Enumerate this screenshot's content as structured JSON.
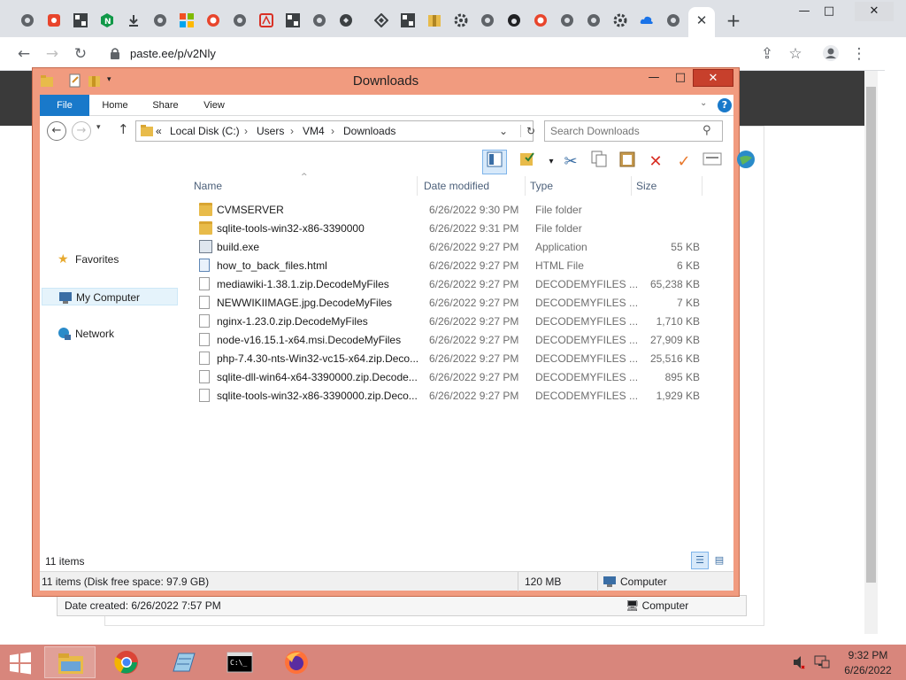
{
  "browser": {
    "url": "paste.ee/p/v2Nly",
    "tab_icons": [
      "chrome-icon",
      "pdf-icon",
      "qr-icon",
      "nginx-icon",
      "download-icon",
      "chrome-icon",
      "windows-icon",
      "opera-icon",
      "chrome-icon",
      "acrobat-icon",
      "qr-icon",
      "shield-icon",
      "maze-icon",
      "qr-icon",
      "archive-icon",
      "gear-icon",
      "chrome-icon",
      "firefox-icon",
      "opera-icon",
      "chrome-icon",
      "chrome-icon",
      "gear-icon",
      "cloud-icon",
      "chrome-icon"
    ],
    "tab_close": "✕",
    "new_tab": "+",
    "page_status": {
      "date_created": "Date created: 6/26/2022 7:57 PM",
      "location": "Computer"
    }
  },
  "explorer": {
    "title": "Downloads",
    "ribbon_tabs": [
      "File",
      "Home",
      "Share",
      "View"
    ],
    "address": {
      "prefix": "«",
      "parts": [
        "Local Disk (C:)",
        "Users",
        "VM4",
        "Downloads"
      ],
      "separator": "›"
    },
    "search_placeholder": "Search Downloads",
    "nav_pane": {
      "favorites": "Favorites",
      "my_computer": "My Computer",
      "network": "Network"
    },
    "columns": {
      "name": "Name",
      "date": "Date modified",
      "type": "Type",
      "size": "Size"
    },
    "files": [
      {
        "name": "CVMSERVER",
        "date": "6/26/2022 9:30 PM",
        "type": "File folder",
        "size": "",
        "kind": "folder"
      },
      {
        "name": "sqlite-tools-win32-x86-3390000",
        "date": "6/26/2022 9:31 PM",
        "type": "File folder",
        "size": "",
        "kind": "folder"
      },
      {
        "name": "build.exe",
        "date": "6/26/2022 9:27 PM",
        "type": "Application",
        "size": "55 KB",
        "kind": "exe"
      },
      {
        "name": "how_to_back_files.html",
        "date": "6/26/2022 9:27 PM",
        "type": "HTML File",
        "size": "6 KB",
        "kind": "html"
      },
      {
        "name": "mediawiki-1.38.1.zip.DecodeMyFiles",
        "date": "6/26/2022 9:27 PM",
        "type": "DECODEMYFILES ...",
        "size": "65,238 KB",
        "kind": "file"
      },
      {
        "name": "NEWWIKIIMAGE.jpg.DecodeMyFiles",
        "date": "6/26/2022 9:27 PM",
        "type": "DECODEMYFILES ...",
        "size": "7 KB",
        "kind": "file"
      },
      {
        "name": "nginx-1.23.0.zip.DecodeMyFiles",
        "date": "6/26/2022 9:27 PM",
        "type": "DECODEMYFILES ...",
        "size": "1,710 KB",
        "kind": "file"
      },
      {
        "name": "node-v16.15.1-x64.msi.DecodeMyFiles",
        "date": "6/26/2022 9:27 PM",
        "type": "DECODEMYFILES ...",
        "size": "27,909 KB",
        "kind": "file"
      },
      {
        "name": "php-7.4.30-nts-Win32-vc15-x64.zip.Deco...",
        "date": "6/26/2022 9:27 PM",
        "type": "DECODEMYFILES ...",
        "size": "25,516 KB",
        "kind": "file"
      },
      {
        "name": "sqlite-dll-win64-x64-3390000.zip.Decode...",
        "date": "6/26/2022 9:27 PM",
        "type": "DECODEMYFILES ...",
        "size": "895 KB",
        "kind": "file"
      },
      {
        "name": "sqlite-tools-win32-x86-3390000.zip.Deco...",
        "date": "6/26/2022 9:27 PM",
        "type": "DECODEMYFILES ...",
        "size": "1,929 KB",
        "kind": "file"
      }
    ],
    "item_count": "11 items",
    "status": {
      "summary": "11 items (Disk free space: 97.9 GB)",
      "size": "120 MB",
      "location": "Computer"
    }
  },
  "taskbar": {
    "apps": [
      "file-explorer",
      "chrome",
      "notepad",
      "command-prompt",
      "firefox"
    ],
    "time": "9:32 PM",
    "date": "6/26/2022"
  },
  "colors": {
    "explorer_frame": "#f19b7f",
    "taskbar": "#d8867c",
    "close_button": "#c7402c",
    "file_tab": "#1979ca"
  }
}
